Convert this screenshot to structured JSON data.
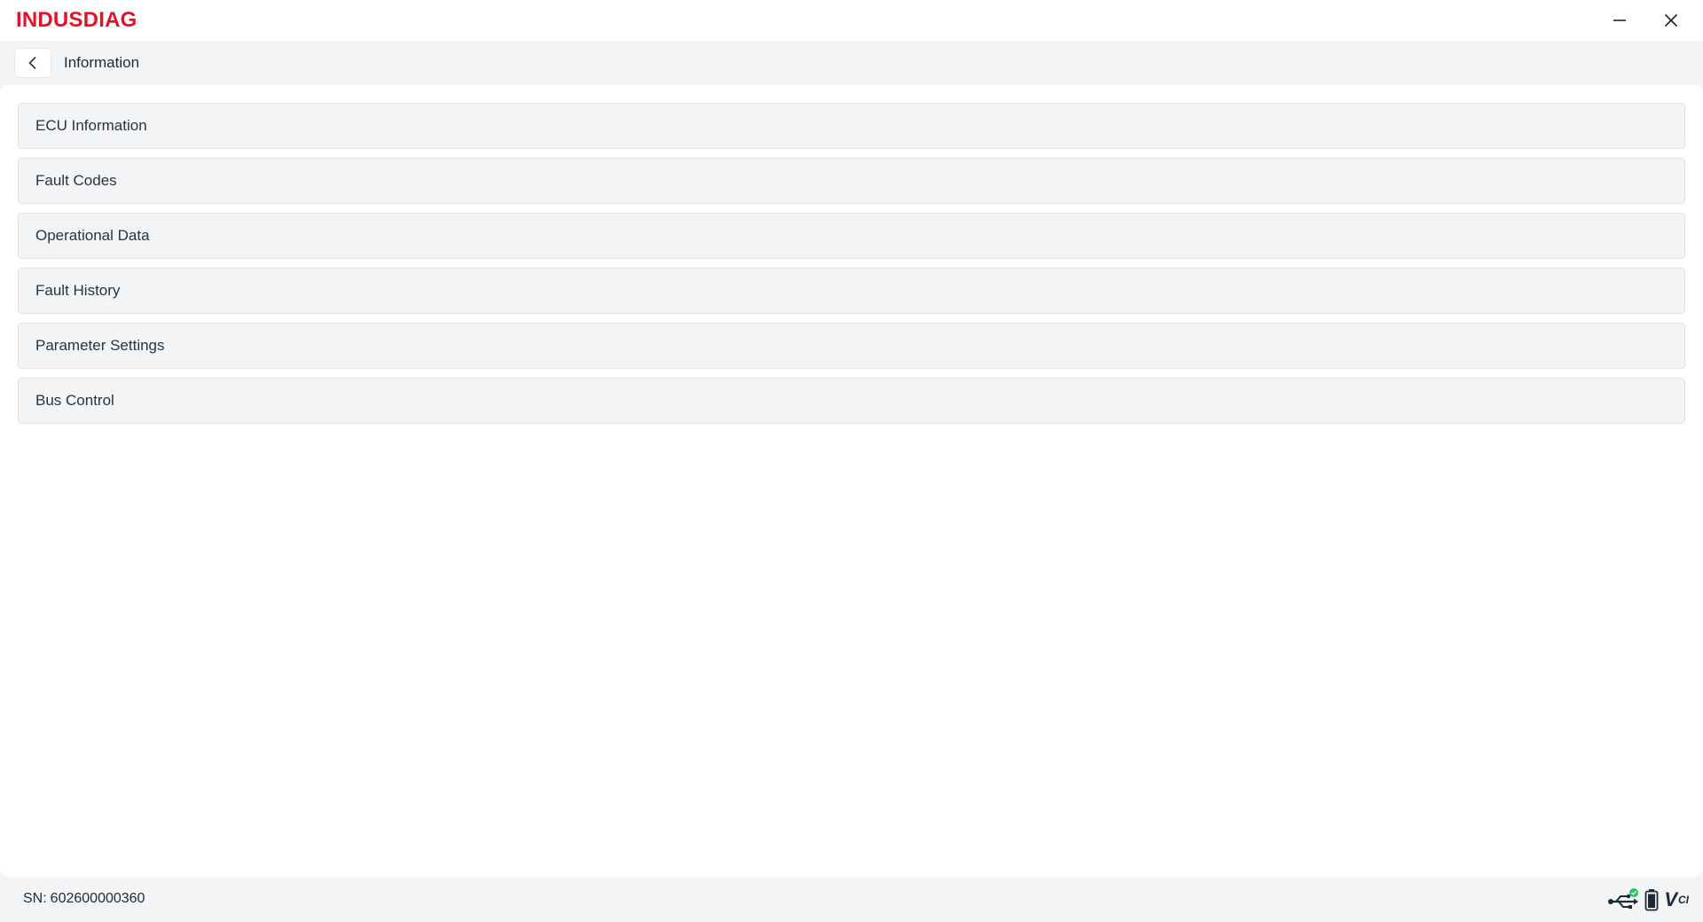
{
  "app": {
    "brand": "INDUSDIAG"
  },
  "window_controls": {
    "minimize_icon": "minimize-icon",
    "close_icon": "close-icon"
  },
  "navbar": {
    "back_icon": "chevron-left-icon",
    "title": "Information"
  },
  "menu": {
    "items": [
      {
        "label": "ECU Information"
      },
      {
        "label": "Fault Codes"
      },
      {
        "label": "Operational Data"
      },
      {
        "label": "Fault History"
      },
      {
        "label": "Parameter Settings"
      },
      {
        "label": "Bus Control"
      }
    ]
  },
  "status": {
    "sn_label": "SN:",
    "sn_value": "602600000360",
    "usb_icon": "usb-connected-icon",
    "battery_icon": "battery-icon",
    "vci_text": "V",
    "vci_sub": "CI"
  },
  "colors": {
    "brand": "#e3122a",
    "connected": "#22c55e"
  }
}
